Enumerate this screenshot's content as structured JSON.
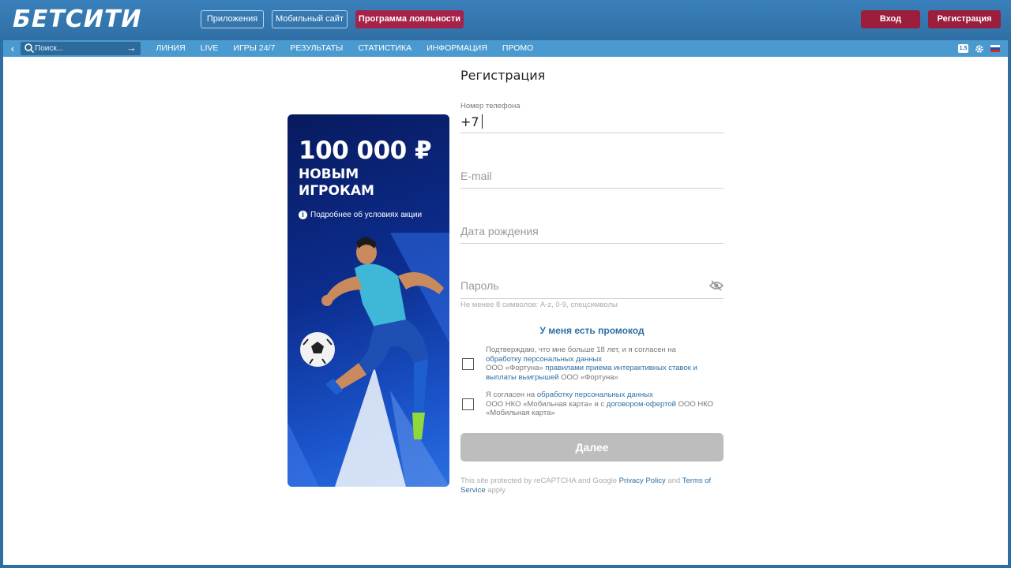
{
  "header": {
    "logo": "БЕТСИТИ",
    "apps_label": "Приложения",
    "mobile_label": "Мобильный сайт",
    "loyalty_label": "Программа лояльности",
    "login_label": "Вход",
    "register_label": "Регистрация"
  },
  "nav": {
    "search_placeholder": "Поиск...",
    "items": [
      "ЛИНИЯ",
      "LIVE",
      "ИГРЫ 24/7",
      "РЕЗУЛЬТАТЫ",
      "СТАТИСТИКА",
      "ИНФОРМАЦИЯ",
      "ПРОМО"
    ],
    "badge": "1.5"
  },
  "promo": {
    "amount": "100 000 ₽",
    "line1": "НОВЫМ",
    "line2": "ИГРОКАМ",
    "more": "Подробнее об условиях акции"
  },
  "form": {
    "title": "Регистрация",
    "phone_label": "Номер телефона",
    "phone_value": "+7",
    "email_placeholder": "E-mail",
    "birth_placeholder": "Дата рождения",
    "password_placeholder": "Пароль",
    "password_hint": "Не менее 8 символов: A-z, 0-9, спецсимволы",
    "promo_code_link": "У меня есть промокод",
    "consent1": {
      "t1": "Подтверждаю, что мне больше 18 лет, и я согласен на",
      "l1": "обработку персональных данных",
      "t2": "ООО «Фортуна»",
      "l2": "правилами приема интерактивных ставок и выплаты выигрышей",
      "t3": "ООО «Фортуна»"
    },
    "consent2": {
      "t1": "Я согласен на",
      "l1": "обработку персональных данных",
      "t2": "ООО НКО «Мобильная карта» и с",
      "l2": "договором-офертой",
      "t3": "ООО НКО «Мобильная карта»"
    },
    "next_label": "Далее",
    "recaptcha": {
      "t1": "This site protected by reCAPTCHA and Google",
      "l1": "Privacy Policy",
      "t2": "and",
      "l2": "Terms of Service",
      "t3": "apply"
    }
  },
  "colors": {
    "header_bg": "#2f6fa5",
    "nav_bg": "#4a9ad0",
    "loyalty_bg": "#a7224a",
    "auth_bg": "#9b1e3d",
    "link": "#2e6fa3",
    "button_disabled": "#bdbdbd"
  }
}
